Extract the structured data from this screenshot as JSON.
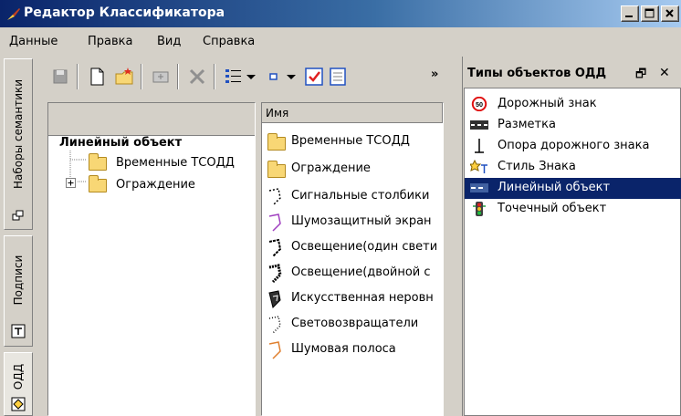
{
  "window": {
    "title": "Редактор Классификатора",
    "controls": [
      "minimize",
      "maximize",
      "close"
    ]
  },
  "menu": [
    {
      "label": "Данные"
    },
    {
      "label": "Правка"
    },
    {
      "label": "Вид"
    },
    {
      "label": "Справка"
    }
  ],
  "left_tabs": [
    {
      "label": "Наборы семантики",
      "icon": "semantic-sets-icon"
    },
    {
      "label": "Подписи",
      "icon": "captions-icon"
    },
    {
      "label": "ОДД",
      "icon": "odd-icon",
      "active": true
    }
  ],
  "toolbar": {
    "overflow_label": "»",
    "buttons": [
      "save-icon",
      "new-document-icon",
      "new-folder-icon",
      "move-icon",
      "delete-icon",
      "list-view-icon",
      "dropdown-icon",
      "small-icons-icon",
      "dropdown-icon",
      "checkbox-icon",
      "properties-icon"
    ]
  },
  "tree": {
    "title": "Линейный объект",
    "items": [
      {
        "label": "Временные ТСОДД",
        "expandable": false
      },
      {
        "label": "Ограждение",
        "expandable": true,
        "expander": "+"
      }
    ]
  },
  "list": {
    "header": "Имя",
    "items": [
      {
        "label": "Временные ТСОДД",
        "icon": "folder-icon"
      },
      {
        "label": "Ограждение",
        "icon": "folder-icon"
      },
      {
        "label": "Сигнальные столбики",
        "icon": "dotted-line-icon"
      },
      {
        "label": "Шумозащитный экран",
        "icon": "screen-line-icon"
      },
      {
        "label": "Освещение(один свети",
        "icon": "lighting-single-icon"
      },
      {
        "label": "Освещение(двойной с",
        "icon": "lighting-double-icon"
      },
      {
        "label": "Искусственная неровн",
        "icon": "speed-bump-icon"
      },
      {
        "label": "Световозвращатели",
        "icon": "reflector-icon"
      },
      {
        "label": "Шумовая полоса",
        "icon": "noise-strip-icon"
      }
    ]
  },
  "types_panel": {
    "title": "Типы объектов ОДД",
    "pin_label": "🗗",
    "close_label": "✕",
    "items": [
      {
        "label": "Дорожный знак",
        "icon": "road-sign-icon",
        "badge": "50"
      },
      {
        "label": "Разметка",
        "icon": "marking-icon"
      },
      {
        "label": "Опора дорожного знака",
        "icon": "sign-post-icon"
      },
      {
        "label": "Стиль Знака",
        "icon": "sign-style-icon"
      },
      {
        "label": "Линейный объект",
        "icon": "linear-object-icon",
        "selected": true
      },
      {
        "label": "Точечный объект",
        "icon": "point-object-icon"
      }
    ]
  },
  "colors": {
    "title_bar": "#0a246a",
    "selection": "#0a246a",
    "folder": "#f8d775",
    "window_bg": "#d4d0c8"
  }
}
